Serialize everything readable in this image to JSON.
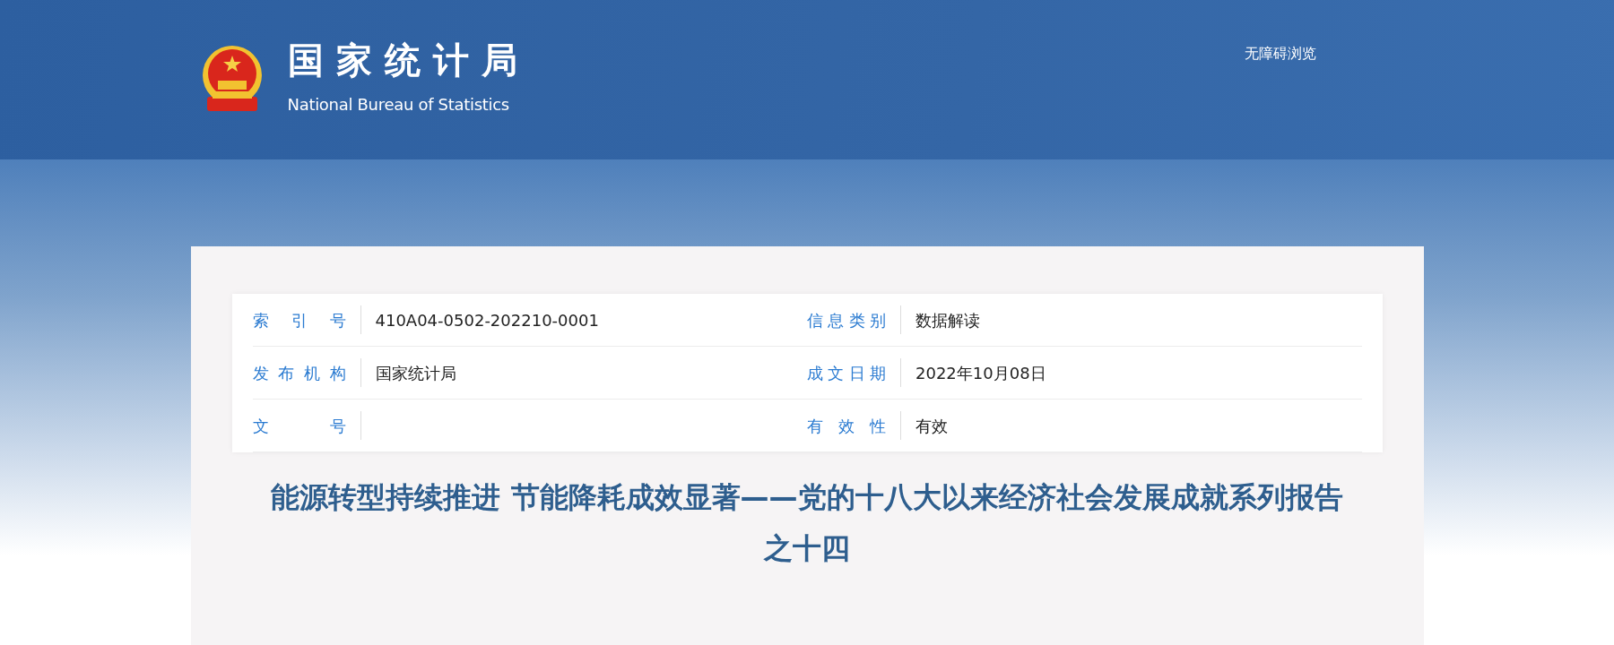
{
  "header": {
    "site_name": "国家统计局",
    "site_name_en": "National Bureau of Statistics",
    "accessibility_link": "无障碍浏览"
  },
  "info_table": {
    "rows": [
      {
        "cells": [
          {
            "label": "索引号",
            "value": "410A04-0502-202210-0001"
          },
          {
            "label": "信息类别",
            "value": "数据解读"
          }
        ]
      },
      {
        "cells": [
          {
            "label": "发布机构",
            "value": "国家统计局"
          },
          {
            "label": "成文日期",
            "value": "2022年10月08日"
          }
        ]
      },
      {
        "cells": [
          {
            "label": "文号"
          },
          {
            "label": "有效性",
            "value": "有效"
          }
        ]
      }
    ]
  },
  "article": {
    "title": "能源转型持续推进 节能降耗成效显著——党的十八大以来经济社会发展成就系列报告之十四"
  }
}
